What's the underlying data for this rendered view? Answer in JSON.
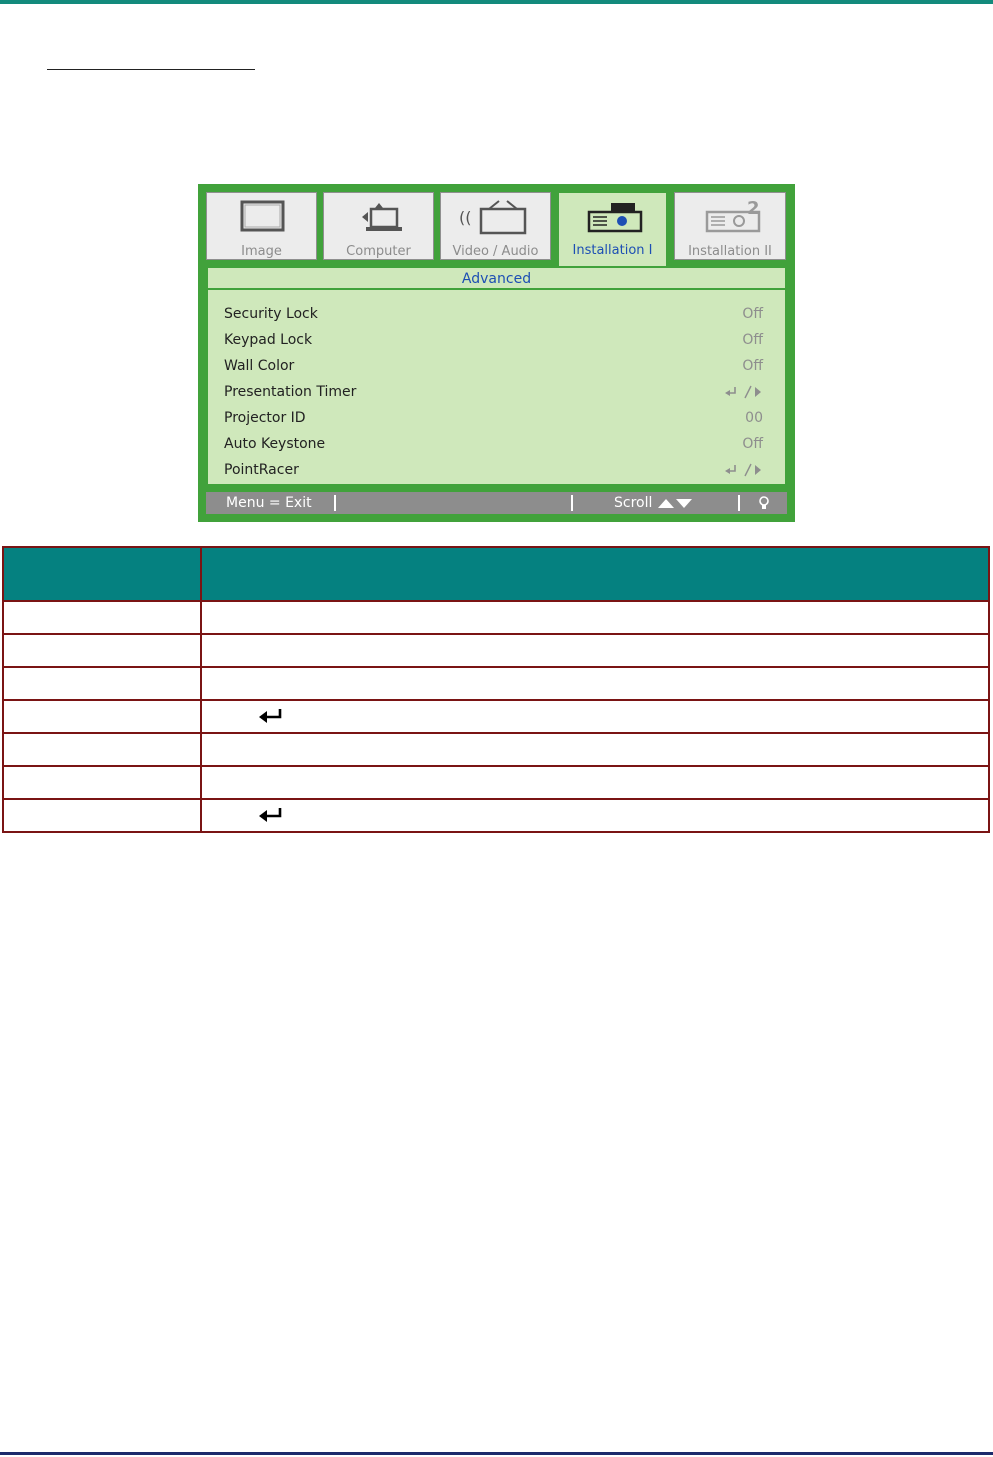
{
  "osd": {
    "tabs": [
      {
        "label": "Image",
        "icon": "monitor-icon",
        "active": false
      },
      {
        "label": "Computer",
        "icon": "computer-icon",
        "active": false
      },
      {
        "label": "Video / Audio",
        "icon": "video-audio-icon",
        "active": false
      },
      {
        "label": "Installation I",
        "icon": "projector-icon",
        "active": true
      },
      {
        "label": "Installation II",
        "icon": "projector-2-icon",
        "active": false
      }
    ],
    "panel_title": "Advanced",
    "items": [
      {
        "label": "Security Lock",
        "value": "Off"
      },
      {
        "label": "Keypad Lock",
        "value": "Off"
      },
      {
        "label": "Wall Color",
        "value": "Off"
      },
      {
        "label": "Presentation Timer",
        "value_icon": "enter-right-arrow-icon"
      },
      {
        "label": "Projector ID",
        "value": "00"
      },
      {
        "label": "Auto Keystone",
        "value": "Off"
      },
      {
        "label": "PointRacer",
        "value_icon": "enter-right-arrow-icon"
      }
    ],
    "footer": {
      "exit_label": "Menu = Exit",
      "scroll_label": "Scroll",
      "scroll_icons": [
        "up-triangle-icon",
        "down-triangle-icon"
      ],
      "help_icon": "bulb-icon"
    }
  },
  "colors": {
    "top_rule": "#138a7c",
    "osd_green": "#41a23b",
    "osd_panel": "#cfe8bb",
    "active_text": "#1d4fb4",
    "table_header": "#058180",
    "table_border": "#7a1414",
    "bottom_rule": "#1c2a6b"
  },
  "table": {
    "rows": [
      {
        "enter_icon": false
      },
      {
        "enter_icon": false
      },
      {
        "enter_icon": false
      },
      {
        "enter_icon": true
      },
      {
        "enter_icon": false
      },
      {
        "enter_icon": false
      },
      {
        "enter_icon": true
      }
    ]
  }
}
